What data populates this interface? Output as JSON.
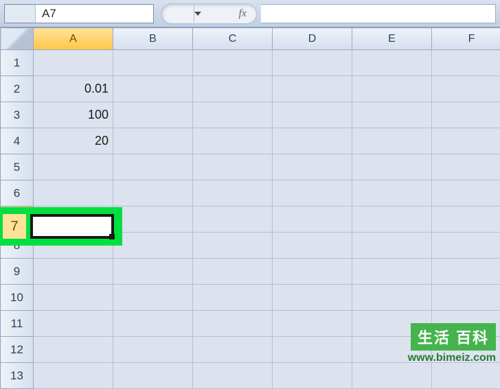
{
  "formula_bar": {
    "name_box_value": "A7",
    "fx_label": "fx",
    "formula_value": ""
  },
  "columns": [
    "A",
    "B",
    "C",
    "D",
    "E",
    "F"
  ],
  "active_column_index": 0,
  "rows": [
    1,
    2,
    3,
    4,
    5,
    6,
    7,
    8,
    9,
    10,
    11,
    12,
    13
  ],
  "active_row_index": 6,
  "cells": {
    "A2": "0.01",
    "A3": "100",
    "A4": "20"
  },
  "highlight": {
    "row_label": "7"
  },
  "watermark": {
    "badge": "生活 百科",
    "url": "www.bimeiz.com"
  }
}
